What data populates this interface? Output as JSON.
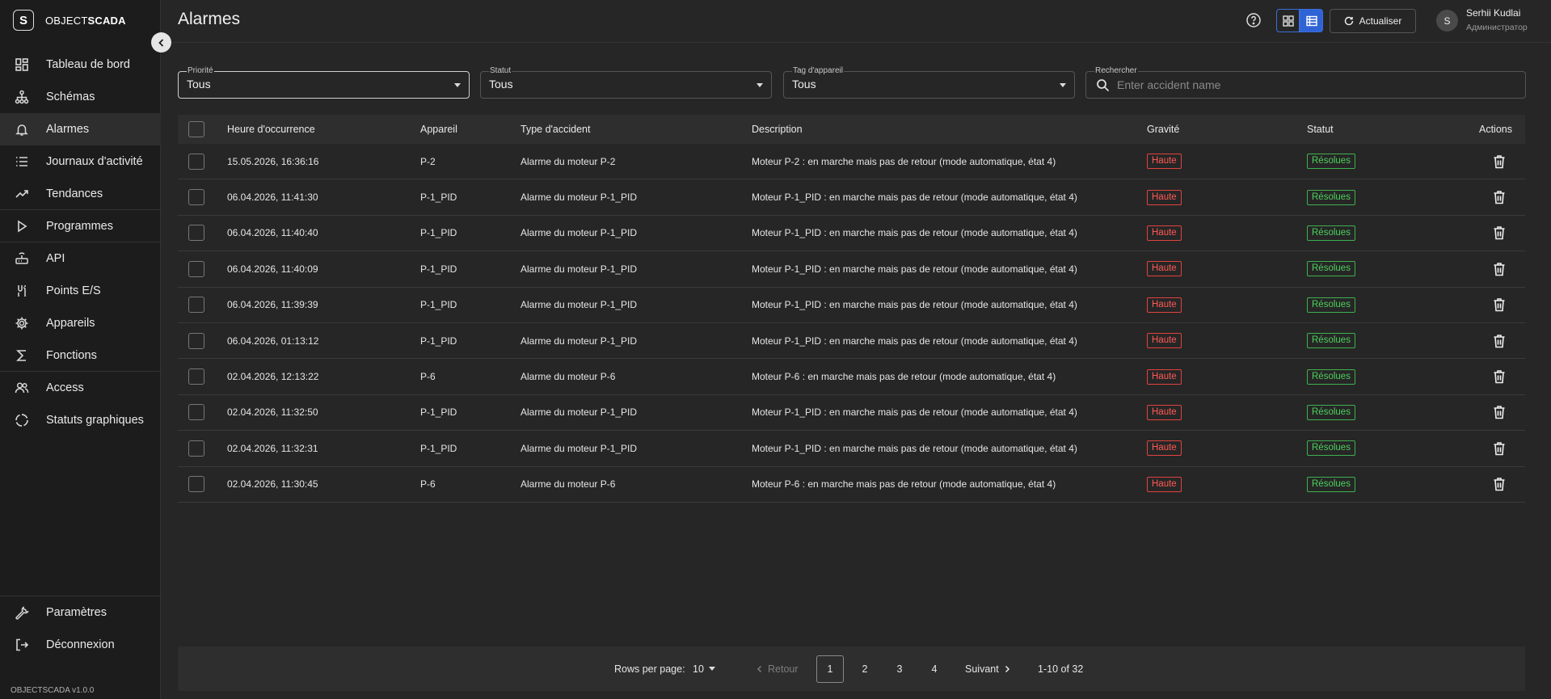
{
  "app": {
    "logo_mark": "S",
    "logo_pre": "OBJECT",
    "logo_bold": "SCADA",
    "version": "OBJECTSCADA v1.0.0"
  },
  "sidebar": {
    "items": [
      {
        "label": "Tableau de bord",
        "icon": "dashboard-icon"
      },
      {
        "label": "Schémas",
        "icon": "sitemap-icon"
      },
      {
        "label": "Alarmes",
        "icon": "bell-icon"
      },
      {
        "label": "Journaux d'activité",
        "icon": "list-icon"
      },
      {
        "label": "Tendances",
        "icon": "trend-icon"
      },
      {
        "label": "Programmes",
        "icon": "play-icon"
      },
      {
        "label": "API",
        "icon": "router-icon"
      },
      {
        "label": "Points E/S",
        "icon": "io-icon"
      },
      {
        "label": "Appareils",
        "icon": "gear-icon"
      },
      {
        "label": "Fonctions",
        "icon": "sigma-icon"
      },
      {
        "label": "Access",
        "icon": "users-icon"
      },
      {
        "label": "Statuts graphiques",
        "icon": "status-icon"
      }
    ],
    "bottom": [
      {
        "label": "Paramètres",
        "icon": "wrench-icon"
      },
      {
        "label": "Déconnexion",
        "icon": "logout-icon"
      }
    ]
  },
  "header": {
    "title": "Alarmes",
    "refresh_label": "Actualiser",
    "user_initial": "S",
    "user_name": "Serhii Kudlai",
    "user_role": "Администратор"
  },
  "filters": {
    "priority": {
      "label": "Priorité",
      "value": "Tous"
    },
    "status": {
      "label": "Statut",
      "value": "Tous"
    },
    "device_tag": {
      "label": "Tag d'appareil",
      "value": "Tous"
    },
    "search": {
      "label": "Rechercher",
      "placeholder": "Enter accident name",
      "value": ""
    }
  },
  "table": {
    "columns": [
      "Heure d'occurrence",
      "Appareil",
      "Type d'accident",
      "Description",
      "Gravité",
      "Statut",
      "Actions"
    ],
    "rows": [
      {
        "time": "15.05.2026, 16:36:16",
        "device": "P-2",
        "type": "Alarme du moteur P-2",
        "description": "Moteur P-2 : en marche mais pas de retour (mode automatique, état 4)",
        "severity": "Haute",
        "status": "Résolues"
      },
      {
        "time": "06.04.2026, 11:41:30",
        "device": "P-1_PID",
        "type": "Alarme du moteur P-1_PID",
        "description": "Moteur P-1_PID : en marche mais pas de retour (mode automatique, état 4)",
        "severity": "Haute",
        "status": "Résolues"
      },
      {
        "time": "06.04.2026, 11:40:40",
        "device": "P-1_PID",
        "type": "Alarme du moteur P-1_PID",
        "description": "Moteur P-1_PID : en marche mais pas de retour (mode automatique, état 4)",
        "severity": "Haute",
        "status": "Résolues"
      },
      {
        "time": "06.04.2026, 11:40:09",
        "device": "P-1_PID",
        "type": "Alarme du moteur P-1_PID",
        "description": "Moteur P-1_PID : en marche mais pas de retour (mode automatique, état 4)",
        "severity": "Haute",
        "status": "Résolues"
      },
      {
        "time": "06.04.2026, 11:39:39",
        "device": "P-1_PID",
        "type": "Alarme du moteur P-1_PID",
        "description": "Moteur P-1_PID : en marche mais pas de retour (mode automatique, état 4)",
        "severity": "Haute",
        "status": "Résolues"
      },
      {
        "time": "06.04.2026, 01:13:12",
        "device": "P-1_PID",
        "type": "Alarme du moteur P-1_PID",
        "description": "Moteur P-1_PID : en marche mais pas de retour (mode automatique, état 4)",
        "severity": "Haute",
        "status": "Résolues"
      },
      {
        "time": "02.04.2026, 12:13:22",
        "device": "P-6",
        "type": "Alarme du moteur P-6",
        "description": "Moteur P-6 : en marche mais pas de retour (mode automatique, état 4)",
        "severity": "Haute",
        "status": "Résolues"
      },
      {
        "time": "02.04.2026, 11:32:50",
        "device": "P-1_PID",
        "type": "Alarme du moteur P-1_PID",
        "description": "Moteur P-1_PID : en marche mais pas de retour (mode automatique, état 4)",
        "severity": "Haute",
        "status": "Résolues"
      },
      {
        "time": "02.04.2026, 11:32:31",
        "device": "P-1_PID",
        "type": "Alarme du moteur P-1_PID",
        "description": "Moteur P-1_PID : en marche mais pas de retour (mode automatique, état 4)",
        "severity": "Haute",
        "status": "Résolues"
      },
      {
        "time": "02.04.2026, 11:30:45",
        "device": "P-6",
        "type": "Alarme du moteur P-6",
        "description": "Moteur P-6 : en marche mais pas de retour (mode automatique, état 4)",
        "severity": "Haute",
        "status": "Résolues"
      }
    ]
  },
  "pagination": {
    "rows_per_page_label": "Rows per page:",
    "rows_per_page": "10",
    "prev_label": "Retour",
    "pages": [
      "1",
      "2",
      "3",
      "4"
    ],
    "current_page": "1",
    "next_label": "Suivant",
    "range": "1-10 of 32"
  },
  "colors": {
    "background": "#262626",
    "sidebar": "#1c1c1c",
    "accent": "#2f63d6",
    "severity_high": "#ff5a55",
    "status_resolved": "#4cd05c"
  }
}
